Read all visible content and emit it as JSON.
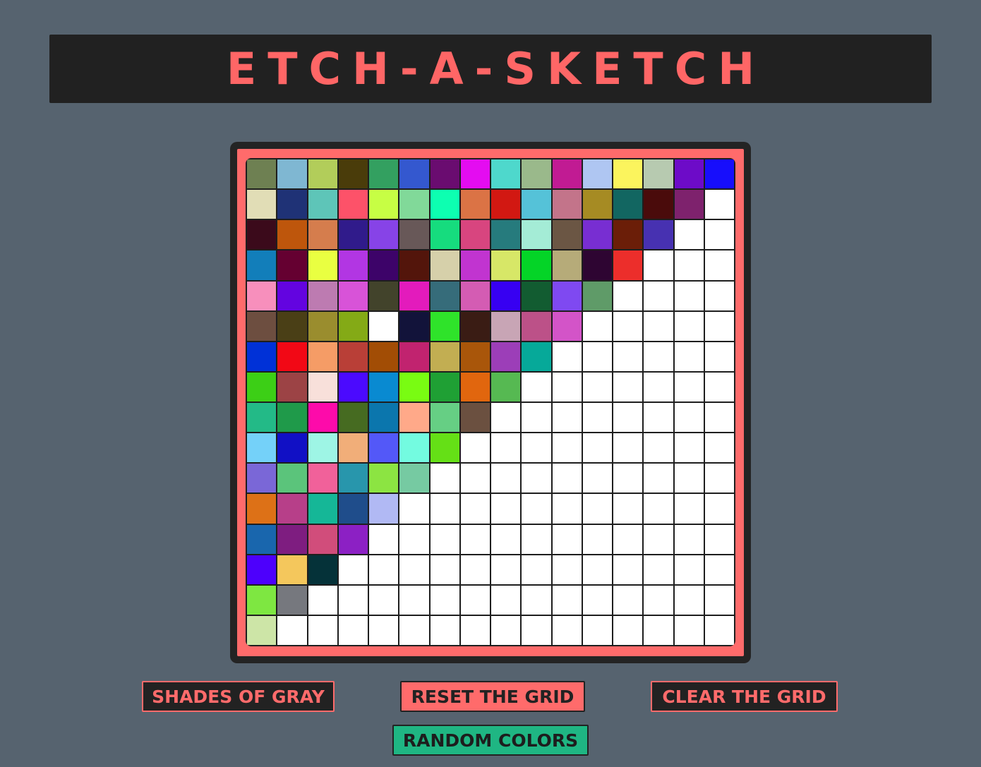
{
  "title": "ETCH-A-SKETCH",
  "buttons": {
    "shades": "SHADES OF GRAY",
    "reset": "RESET THE GRID",
    "clear": "CLEAR THE GRID",
    "random": "RANDOM COLORS"
  },
  "colors": {
    "background": "#56636f",
    "title_bar": "#212121",
    "accent": "#ff6b6b",
    "green_button": "#1fb683"
  },
  "grid": {
    "size": 16,
    "empty_color": "#ffffff",
    "rows": [
      [
        "#6e8052",
        "#7fb7d2",
        "#b2cd5a",
        "#4a3c0a",
        "#33a060",
        "#3458cf",
        "#6a0c70",
        "#e40cf1",
        "#4ed8cc",
        "#9ab98b",
        "#c11b93",
        "#afc6f2",
        "#fbf45d",
        "#b7cab0",
        "#6d0bc8",
        "#170efc"
      ],
      [
        "#e1ddb6",
        "#1f3276",
        "#5ec5b8",
        "#fd5269",
        "#c7fe44",
        "#81d999",
        "#0dffb1",
        "#db7345",
        "#d21812",
        "#55c2d8",
        "#c3748a",
        "#a68b23",
        "#126661",
        "#4a0b0b",
        "#7e226d",
        null
      ],
      [
        "#3b0a1b",
        "#be560c",
        "#d57d4d",
        "#301b8b",
        "#8743e7",
        "#685858",
        "#16dc7e",
        "#d8457f",
        "#267b7d",
        "#a4ecd6",
        "#6b5644",
        "#782ed2",
        "#6b1e08",
        "#4731b1",
        null,
        null
      ],
      [
        "#127eba",
        "#650031",
        "#e9ff41",
        "#b236e3",
        "#3d0369",
        "#53150b",
        "#d6d0aa",
        "#c134d0",
        "#d7e767",
        "#04d427",
        "#b6ab79",
        "#2e0532",
        "#ec2e2b",
        null,
        null,
        null
      ],
      [
        "#f78fbc",
        "#6304e0",
        "#bd7bb1",
        "#d853d8",
        "#42432b",
        "#e31bbc",
        "#366c7a",
        "#d45cb3",
        "#3700f2",
        "#125c31",
        "#7f49f1",
        "#5f9b68",
        null,
        null,
        null,
        null
      ],
      [
        "#6d4e40",
        "#4a3f16",
        "#9a8d2e",
        "#84aa16",
        null,
        "#12133a",
        "#2fe32a",
        "#3a1c14",
        "#c8a5b5",
        "#bc5188",
        "#d354c8",
        null,
        null,
        null,
        null,
        null
      ],
      [
        "#0031d7",
        "#f20815",
        "#f59c66",
        "#b93f37",
        "#a24d05",
        "#c1236f",
        "#c2ae52",
        "#a9560a",
        "#9c3eb8",
        "#06a999",
        null,
        null,
        null,
        null,
        null,
        null
      ],
      [
        "#3ccf16",
        "#9c4345",
        "#f8e0da",
        "#4b0afe",
        "#098ad1",
        "#79fc12",
        "#1fa034",
        "#e1660e",
        "#56b952",
        null,
        null,
        null,
        null,
        null,
        null,
        null
      ],
      [
        "#23ba87",
        "#1f9a4a",
        "#fd0baa",
        "#466b21",
        "#0b76ad",
        "#ffa989",
        "#66cf84",
        "#6b5040",
        null,
        null,
        null,
        null,
        null,
        null,
        null,
        null
      ],
      [
        "#74d1f9",
        "#1110c5",
        "#9ef5e5",
        "#f1ae79",
        "#5358f8",
        "#73fbe0",
        "#65e016",
        null,
        null,
        null,
        null,
        null,
        null,
        null,
        null,
        null
      ],
      [
        "#7a67d7",
        "#5bc47b",
        "#f1619a",
        "#2896ac",
        "#8ce442",
        "#76caa2",
        null,
        null,
        null,
        null,
        null,
        null,
        null,
        null,
        null,
        null
      ],
      [
        "#dd7117",
        "#b73f89",
        "#15b797",
        "#1f4d8b",
        "#b1b9f4",
        null,
        null,
        null,
        null,
        null,
        null,
        null,
        null,
        null,
        null,
        null
      ],
      [
        "#1966ad",
        "#7e1d80",
        "#d14d7b",
        "#8c20c4",
        null,
        null,
        null,
        null,
        null,
        null,
        null,
        null,
        null,
        null,
        null,
        null
      ],
      [
        "#4d00fc",
        "#f4c75c",
        "#053239",
        null,
        null,
        null,
        null,
        null,
        null,
        null,
        null,
        null,
        null,
        null,
        null,
        null
      ],
      [
        "#7ee741",
        "#76787e",
        null,
        null,
        null,
        null,
        null,
        null,
        null,
        null,
        null,
        null,
        null,
        null,
        null,
        null
      ],
      [
        "#cde5a7",
        null,
        null,
        null,
        null,
        null,
        null,
        null,
        null,
        null,
        null,
        null,
        null,
        null,
        null,
        null
      ]
    ]
  }
}
